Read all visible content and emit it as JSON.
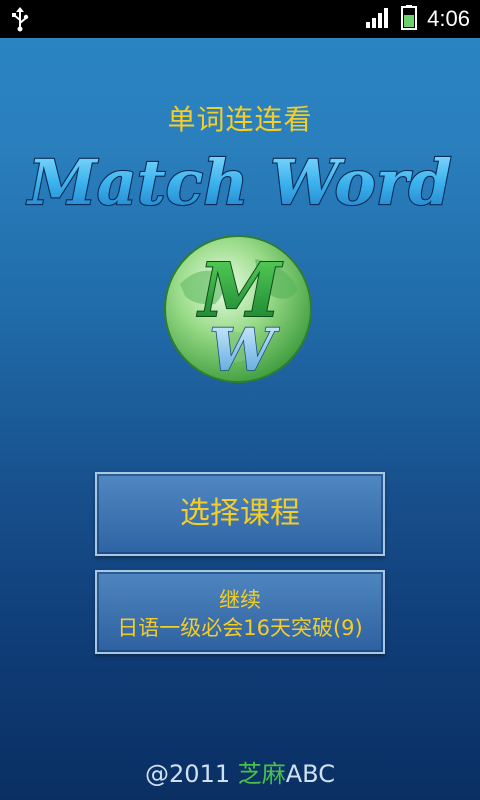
{
  "status_bar": {
    "time": "4:06",
    "icons": [
      "usb-icon",
      "signal-icon",
      "battery-icon"
    ]
  },
  "app": {
    "subtitle": "单词连连看",
    "title": "Match Word",
    "logo_letters": [
      "M",
      "W"
    ]
  },
  "buttons": {
    "select_course": "选择课程",
    "continue_label": "继续",
    "continue_course": "日语一级必会16天突破(9)"
  },
  "footer": {
    "prefix": "@2011 ",
    "brand": "芝麻",
    "suffix": "ABC"
  },
  "colors": {
    "accent_yellow": "#f4cd27",
    "brand_green": "#49c04a",
    "title_blue": "#3cb3ee"
  }
}
